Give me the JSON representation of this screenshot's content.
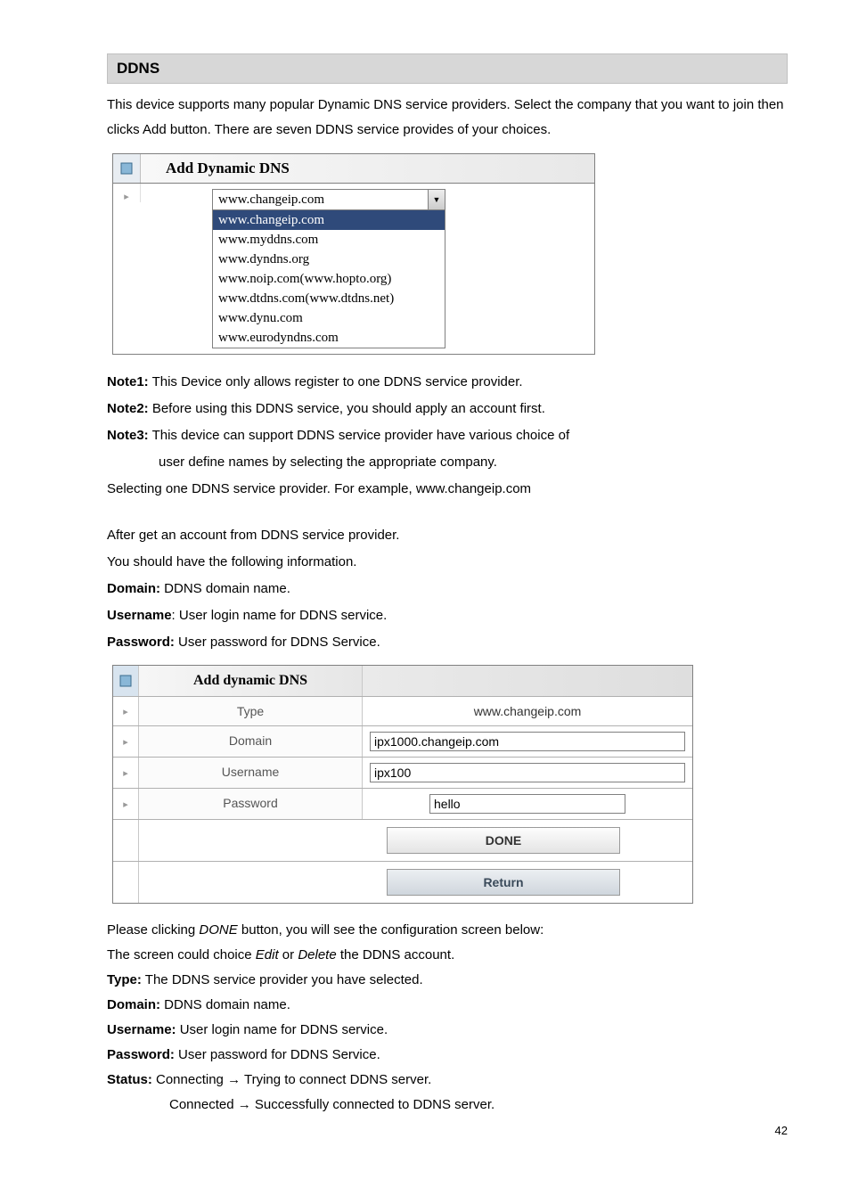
{
  "section_title": "DDNS",
  "intro": "This device supports many popular Dynamic DNS service providers. Select the company that you want to join then clicks Add button. There are seven DDNS service provides of your choices.",
  "fig1": {
    "title": "Add Dynamic DNS",
    "selected": "www.changeip.com",
    "options": [
      "www.changeip.com",
      "www.myddns.com",
      "www.dyndns.org",
      "www.noip.com(www.hopto.org)",
      "www.dtdns.com(www.dtdns.net)",
      "www.dynu.com",
      "www.eurodyndns.com"
    ]
  },
  "notes": {
    "n1_label": "Note1:",
    "n1_text": " This Device only allows register to one DDNS service provider.",
    "n2_label": "Note2:",
    "n2_text": " Before using this DDNS service, you should apply an account first.",
    "n3_label": "Note3:",
    "n3_text": " This device can support DDNS service provider have various choice of",
    "n3_cont": "user define names by selecting the appropriate company.",
    "sel_line": "Selecting one DDNS service provider. For example, www.changeip.com",
    "after1": "After get an account from DDNS service provider.",
    "after2": "You should have the following information.",
    "domain_l": "Domain:",
    "domain_t": " DDNS domain name.",
    "user_l": "Username",
    "user_t": ": User login name for DDNS service.",
    "pass_l": "Password:",
    "pass_t": " User password for DDNS Service."
  },
  "fig2": {
    "title": "Add dynamic DNS",
    "rows": {
      "type_l": "Type",
      "type_v": "www.changeip.com",
      "domain_l": "Domain",
      "domain_v": "ipx1000.changeip.com",
      "user_l": "Username",
      "user_v": "ipx100",
      "pass_l": "Password",
      "pass_v": "hello"
    },
    "done": "DONE",
    "return": "Return"
  },
  "after_fig2": {
    "l1a": "Please clicking ",
    "l1b": "DONE",
    "l1c": " button, you will see the configuration screen below:",
    "l2a": "The screen could choice ",
    "l2b": "Edit",
    "l2c": " or ",
    "l2d": "Delete",
    "l2e": " the DDNS account.",
    "type_l": "Type:",
    "type_t": " The DDNS service provider you have selected.",
    "domain_l": "Domain:",
    "domain_t": " DDNS domain name.",
    "user_l": "Username:",
    "user_t": " User login name for DDNS service.",
    "pass_l": "Password:",
    "pass_t": " User password for DDNS Service.",
    "status_l": "Status:",
    "status_t1": "  Connecting → Trying to connect DDNS server.",
    "status_t2": "Connected → Successfully connected to DDNS server."
  },
  "page_number": "42"
}
